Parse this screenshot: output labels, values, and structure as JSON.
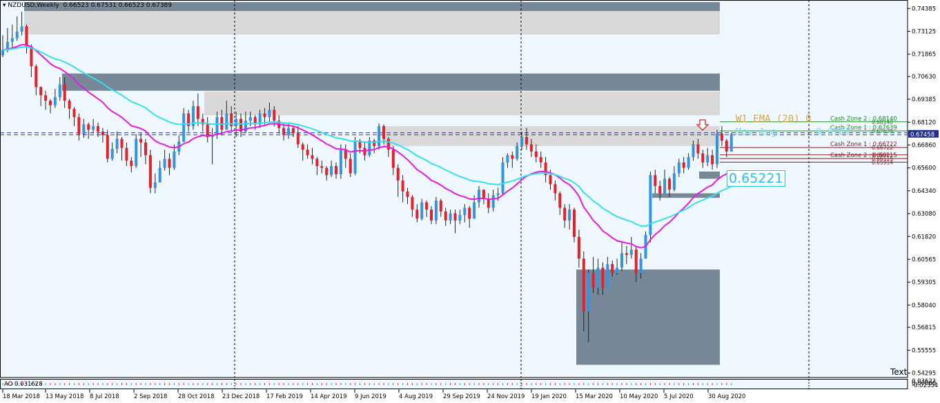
{
  "header": {
    "symbol": "NZDUSD,Weekly",
    "ohlc": "0.66523 0.67531 0.66523 0.67389"
  },
  "colors": {
    "background": "#f0f8ff",
    "bull": "#2f95e8",
    "bear": "#ee1c25",
    "ema_slow": "#e619e6",
    "ema_fast": "#33e0ee",
    "zone_light": "#d9d9d9",
    "zone_dark": "#778899",
    "price_line": "#1f2f8f"
  },
  "labels": {
    "ema_label": "W1 EMA (20) 0",
    "mov_avg": "Mov Avg",
    "mov_avg_value": "0.6707",
    "ema_value": "0.65221",
    "current_price": "0.67458",
    "corner_text": "Text"
  },
  "indicator": {
    "name": "AO 0.031628",
    "scale_labels": [
      "0.03622",
      "0.00000",
      "-0.02354"
    ]
  },
  "chart_data": {
    "type": "candlestick",
    "symbol": "NZDUSD",
    "timeframe": "Weekly",
    "ylim": [
      0.5405,
      0.7485
    ],
    "y_ticks": [
      "0.74385",
      "0.73125",
      "0.71865",
      "0.70630",
      "0.69385",
      "0.68120",
      "0.66860",
      "0.65600",
      "0.64340",
      "0.63080",
      "0.61820",
      "0.60565",
      "0.59305",
      "0.58040",
      "0.56815",
      "0.55555",
      "0.54295"
    ],
    "x_ticks": [
      "18 Mar 2018",
      "13 May 2018",
      "8 Jul 2018",
      "2 Sep 2018",
      "28 Oct 2018",
      "23 Dec 2018",
      "17 Feb 2019",
      "14 Apr 2019",
      "9 Jun 2019",
      "4 Aug 2019",
      "29 Sep 2019",
      "24 Nov 2019",
      "19 Jan 2020",
      "15 Mar 2020",
      "10 May 2020",
      "5 Jul 2020",
      "30 Aug 2020"
    ],
    "start_date": "2018-03-18",
    "close_start": 0.721,
    "candles": [
      {
        "c": 0.721,
        "h": 0.729,
        "l": 0.717
      },
      {
        "c": 0.7255,
        "h": 0.733,
        "l": 0.7195
      },
      {
        "c": 0.7275,
        "h": 0.735,
        "l": 0.722
      },
      {
        "c": 0.731,
        "h": 0.7395,
        "l": 0.726
      },
      {
        "c": 0.734,
        "h": 0.742,
        "l": 0.729
      },
      {
        "c": 0.723,
        "h": 0.735,
        "l": 0.719
      },
      {
        "c": 0.712,
        "h": 0.724,
        "l": 0.706
      },
      {
        "c": 0.7005,
        "h": 0.713,
        "l": 0.696
      },
      {
        "c": 0.696,
        "h": 0.701,
        "l": 0.69
      },
      {
        "c": 0.693,
        "h": 0.6985,
        "l": 0.688
      },
      {
        "c": 0.6905,
        "h": 0.694,
        "l": 0.686
      },
      {
        "c": 0.695,
        "h": 0.6995,
        "l": 0.689
      },
      {
        "c": 0.702,
        "h": 0.706,
        "l": 0.693
      },
      {
        "c": 0.693,
        "h": 0.706,
        "l": 0.689
      },
      {
        "c": 0.6885,
        "h": 0.694,
        "l": 0.683
      },
      {
        "c": 0.684,
        "h": 0.6895,
        "l": 0.679
      },
      {
        "c": 0.6745,
        "h": 0.686,
        "l": 0.671
      },
      {
        "c": 0.68,
        "h": 0.683,
        "l": 0.6725
      },
      {
        "c": 0.677,
        "h": 0.681,
        "l": 0.672
      },
      {
        "c": 0.679,
        "h": 0.683,
        "l": 0.675
      },
      {
        "c": 0.676,
        "h": 0.681,
        "l": 0.673
      },
      {
        "c": 0.674,
        "h": 0.678,
        "l": 0.67
      },
      {
        "c": 0.661,
        "h": 0.677,
        "l": 0.659
      },
      {
        "c": 0.6665,
        "h": 0.67,
        "l": 0.66
      },
      {
        "c": 0.672,
        "h": 0.676,
        "l": 0.664
      },
      {
        "c": 0.667,
        "h": 0.673,
        "l": 0.66
      },
      {
        "c": 0.66,
        "h": 0.67,
        "l": 0.657
      },
      {
        "c": 0.657,
        "h": 0.662,
        "l": 0.6535
      },
      {
        "c": 0.672,
        "h": 0.6745,
        "l": 0.656
      },
      {
        "c": 0.67,
        "h": 0.675,
        "l": 0.662
      },
      {
        "c": 0.663,
        "h": 0.672,
        "l": 0.658
      },
      {
        "c": 0.645,
        "h": 0.666,
        "l": 0.642
      },
      {
        "c": 0.648,
        "h": 0.653,
        "l": 0.642
      },
      {
        "c": 0.656,
        "h": 0.66,
        "l": 0.65
      },
      {
        "c": 0.661,
        "h": 0.666,
        "l": 0.6545
      },
      {
        "c": 0.656,
        "h": 0.664,
        "l": 0.652
      },
      {
        "c": 0.665,
        "h": 0.669,
        "l": 0.655
      },
      {
        "c": 0.6705,
        "h": 0.674,
        "l": 0.663
      },
      {
        "c": 0.686,
        "h": 0.689,
        "l": 0.67
      },
      {
        "c": 0.679,
        "h": 0.688,
        "l": 0.676
      },
      {
        "c": 0.69,
        "h": 0.693,
        "l": 0.677
      },
      {
        "c": 0.683,
        "h": 0.697,
        "l": 0.679
      },
      {
        "c": 0.68,
        "h": 0.686,
        "l": 0.676
      },
      {
        "c": 0.673,
        "h": 0.684,
        "l": 0.67
      },
      {
        "c": 0.674,
        "h": 0.678,
        "l": 0.658
      },
      {
        "c": 0.684,
        "h": 0.687,
        "l": 0.672
      },
      {
        "c": 0.677,
        "h": 0.688,
        "l": 0.674
      },
      {
        "c": 0.686,
        "h": 0.693,
        "l": 0.677
      },
      {
        "c": 0.679,
        "h": 0.69,
        "l": 0.676
      },
      {
        "c": 0.683,
        "h": 0.687,
        "l": 0.673
      },
      {
        "c": 0.676,
        "h": 0.686,
        "l": 0.673
      },
      {
        "c": 0.682,
        "h": 0.687,
        "l": 0.675
      },
      {
        "c": 0.684,
        "h": 0.687,
        "l": 0.679
      },
      {
        "c": 0.68,
        "h": 0.685,
        "l": 0.677
      },
      {
        "c": 0.686,
        "h": 0.688,
        "l": 0.678
      },
      {
        "c": 0.684,
        "h": 0.689,
        "l": 0.68
      },
      {
        "c": 0.688,
        "h": 0.692,
        "l": 0.681
      },
      {
        "c": 0.682,
        "h": 0.69,
        "l": 0.679
      },
      {
        "c": 0.678,
        "h": 0.685,
        "l": 0.675
      },
      {
        "c": 0.674,
        "h": 0.681,
        "l": 0.671
      },
      {
        "c": 0.678,
        "h": 0.681,
        "l": 0.672
      },
      {
        "c": 0.675,
        "h": 0.679,
        "l": 0.673
      },
      {
        "c": 0.669,
        "h": 0.679,
        "l": 0.667
      },
      {
        "c": 0.666,
        "h": 0.67,
        "l": 0.66
      },
      {
        "c": 0.663,
        "h": 0.669,
        "l": 0.661
      },
      {
        "c": 0.661,
        "h": 0.667,
        "l": 0.658
      },
      {
        "c": 0.657,
        "h": 0.662,
        "l": 0.652
      },
      {
        "c": 0.656,
        "h": 0.66,
        "l": 0.653
      },
      {
        "c": 0.652,
        "h": 0.657,
        "l": 0.649
      },
      {
        "c": 0.657,
        "h": 0.66,
        "l": 0.651
      },
      {
        "c": 0.6525,
        "h": 0.659,
        "l": 0.65
      },
      {
        "c": 0.666,
        "h": 0.669,
        "l": 0.65
      },
      {
        "c": 0.661,
        "h": 0.669,
        "l": 0.656
      },
      {
        "c": 0.653,
        "h": 0.664,
        "l": 0.651
      },
      {
        "c": 0.671,
        "h": 0.673,
        "l": 0.652
      },
      {
        "c": 0.667,
        "h": 0.672,
        "l": 0.664
      },
      {
        "c": 0.663,
        "h": 0.67,
        "l": 0.66
      },
      {
        "c": 0.671,
        "h": 0.673,
        "l": 0.662
      },
      {
        "c": 0.668,
        "h": 0.672,
        "l": 0.664
      },
      {
        "c": 0.679,
        "h": 0.6805,
        "l": 0.666
      },
      {
        "c": 0.672,
        "h": 0.68,
        "l": 0.669
      },
      {
        "c": 0.666,
        "h": 0.673,
        "l": 0.662
      },
      {
        "c": 0.656,
        "h": 0.668,
        "l": 0.652
      },
      {
        "c": 0.649,
        "h": 0.658,
        "l": 0.64
      },
      {
        "c": 0.643,
        "h": 0.652,
        "l": 0.637
      },
      {
        "c": 0.64,
        "h": 0.645,
        "l": 0.636
      },
      {
        "c": 0.633,
        "h": 0.641,
        "l": 0.629
      },
      {
        "c": 0.628,
        "h": 0.636,
        "l": 0.626
      },
      {
        "c": 0.637,
        "h": 0.639,
        "l": 0.627
      },
      {
        "c": 0.633,
        "h": 0.638,
        "l": 0.629
      },
      {
        "c": 0.627,
        "h": 0.635,
        "l": 0.625
      },
      {
        "c": 0.638,
        "h": 0.64,
        "l": 0.625
      },
      {
        "c": 0.632,
        "h": 0.639,
        "l": 0.629
      },
      {
        "c": 0.627,
        "h": 0.634,
        "l": 0.624
      },
      {
        "c": 0.631,
        "h": 0.633,
        "l": 0.625
      },
      {
        "c": 0.627,
        "h": 0.633,
        "l": 0.62
      },
      {
        "c": 0.63,
        "h": 0.633,
        "l": 0.625
      },
      {
        "c": 0.634,
        "h": 0.636,
        "l": 0.626
      },
      {
        "c": 0.628,
        "h": 0.635,
        "l": 0.623
      },
      {
        "c": 0.637,
        "h": 0.641,
        "l": 0.628
      },
      {
        "c": 0.644,
        "h": 0.646,
        "l": 0.634
      },
      {
        "c": 0.639,
        "h": 0.644,
        "l": 0.636
      },
      {
        "c": 0.634,
        "h": 0.642,
        "l": 0.631
      },
      {
        "c": 0.641,
        "h": 0.644,
        "l": 0.632
      },
      {
        "c": 0.642,
        "h": 0.645,
        "l": 0.638
      },
      {
        "c": 0.659,
        "h": 0.662,
        "l": 0.641
      },
      {
        "c": 0.663,
        "h": 0.664,
        "l": 0.656
      },
      {
        "c": 0.661,
        "h": 0.665,
        "l": 0.656
      },
      {
        "c": 0.668,
        "h": 0.67,
        "l": 0.66
      },
      {
        "c": 0.673,
        "h": 0.676,
        "l": 0.666
      },
      {
        "c": 0.669,
        "h": 0.678,
        "l": 0.666
      },
      {
        "c": 0.665,
        "h": 0.672,
        "l": 0.662
      },
      {
        "c": 0.662,
        "h": 0.669,
        "l": 0.659
      },
      {
        "c": 0.659,
        "h": 0.665,
        "l": 0.656
      },
      {
        "c": 0.652,
        "h": 0.662,
        "l": 0.648
      },
      {
        "c": 0.647,
        "h": 0.655,
        "l": 0.644
      },
      {
        "c": 0.642,
        "h": 0.649,
        "l": 0.638
      },
      {
        "c": 0.634,
        "h": 0.643,
        "l": 0.63
      },
      {
        "c": 0.627,
        "h": 0.636,
        "l": 0.623
      },
      {
        "c": 0.633,
        "h": 0.636,
        "l": 0.622
      },
      {
        "c": 0.618,
        "h": 0.634,
        "l": 0.615
      },
      {
        "c": 0.606,
        "h": 0.622,
        "l": 0.601
      },
      {
        "c": 0.577,
        "h": 0.61,
        "l": 0.566
      },
      {
        "c": 0.598,
        "h": 0.6,
        "l": 0.56
      },
      {
        "c": 0.59,
        "h": 0.607,
        "l": 0.587
      },
      {
        "c": 0.601,
        "h": 0.606,
        "l": 0.586
      },
      {
        "c": 0.59,
        "h": 0.604,
        "l": 0.586
      },
      {
        "c": 0.603,
        "h": 0.607,
        "l": 0.593
      },
      {
        "c": 0.598,
        "h": 0.605,
        "l": 0.596
      },
      {
        "c": 0.601,
        "h": 0.606,
        "l": 0.597
      },
      {
        "c": 0.609,
        "h": 0.615,
        "l": 0.599
      },
      {
        "c": 0.608,
        "h": 0.613,
        "l": 0.603
      },
      {
        "c": 0.611,
        "h": 0.618,
        "l": 0.606
      },
      {
        "c": 0.598,
        "h": 0.613,
        "l": 0.593
      },
      {
        "c": 0.606,
        "h": 0.609,
        "l": 0.595
      },
      {
        "c": 0.619,
        "h": 0.621,
        "l": 0.606
      },
      {
        "c": 0.652,
        "h": 0.654,
        "l": 0.615
      },
      {
        "c": 0.646,
        "h": 0.655,
        "l": 0.642
      },
      {
        "c": 0.642,
        "h": 0.649,
        "l": 0.638
      },
      {
        "c": 0.65,
        "h": 0.655,
        "l": 0.642
      },
      {
        "c": 0.644,
        "h": 0.651,
        "l": 0.64
      },
      {
        "c": 0.653,
        "h": 0.657,
        "l": 0.643
      },
      {
        "c": 0.659,
        "h": 0.661,
        "l": 0.651
      },
      {
        "c": 0.656,
        "h": 0.662,
        "l": 0.653
      },
      {
        "c": 0.662,
        "h": 0.664,
        "l": 0.655
      },
      {
        "c": 0.669,
        "h": 0.671,
        "l": 0.66
      },
      {
        "c": 0.664,
        "h": 0.672,
        "l": 0.661
      },
      {
        "c": 0.659,
        "h": 0.666,
        "l": 0.656
      },
      {
        "c": 0.663,
        "h": 0.667,
        "l": 0.657
      },
      {
        "c": 0.658,
        "h": 0.666,
        "l": 0.655
      },
      {
        "c": 0.675,
        "h": 0.677,
        "l": 0.656
      },
      {
        "c": 0.671,
        "h": 0.679,
        "l": 0.668
      },
      {
        "c": 0.665,
        "h": 0.672,
        "l": 0.662
      },
      {
        "c": 0.6746,
        "h": 0.6753,
        "l": 0.6652
      }
    ],
    "ema_slow": {
      "name": "W1 EMA (20)",
      "color": "#e619e6"
    },
    "ema_fast": {
      "name": "Mov Avg",
      "color": "#33e0ee"
    },
    "zones": [
      {
        "top": 0.747,
        "bottom": 0.7295,
        "kind": "light"
      },
      {
        "top": 0.705,
        "bottom": 0.702,
        "kind": "light_dash"
      },
      {
        "top": 0.708,
        "bottom": 0.6985,
        "kind": "dark"
      },
      {
        "top": 0.698,
        "bottom": 0.685,
        "kind": "light"
      },
      {
        "top": 0.679,
        "bottom": 0.668,
        "kind": "light"
      },
      {
        "top": 0.699,
        "bottom": 0.6985,
        "kind": "light"
      },
      {
        "top": 0.654,
        "bottom": 0.65,
        "kind": "dark_small"
      },
      {
        "top": 0.642,
        "bottom": 0.64,
        "kind": "dark_small2"
      },
      {
        "top": 0.6,
        "bottom": 0.5475,
        "kind": "dark_big"
      }
    ],
    "levels": [
      {
        "label": "Cash Zone 2 : 0.68140",
        "value": 0.6814,
        "color": "#208a20"
      },
      {
        "label": "Cash Zone 1 : 0.67639",
        "value": 0.67639,
        "color": "#208a20"
      },
      {
        "label": "Cash Zone 1 : 0.66722",
        "value": 0.66722,
        "color": "#8b1a1a"
      },
      {
        "label": "Cash Zone 2 : 0.66115",
        "value": 0.66115,
        "color": "#8b1a1a"
      }
    ],
    "level_prices": [
      "0.68140",
      "0.67639",
      "0.66722",
      "0.66321",
      "0.66115",
      "0.65914"
    ],
    "current_price": 0.67458,
    "ema_fast_last": 0.65221
  }
}
